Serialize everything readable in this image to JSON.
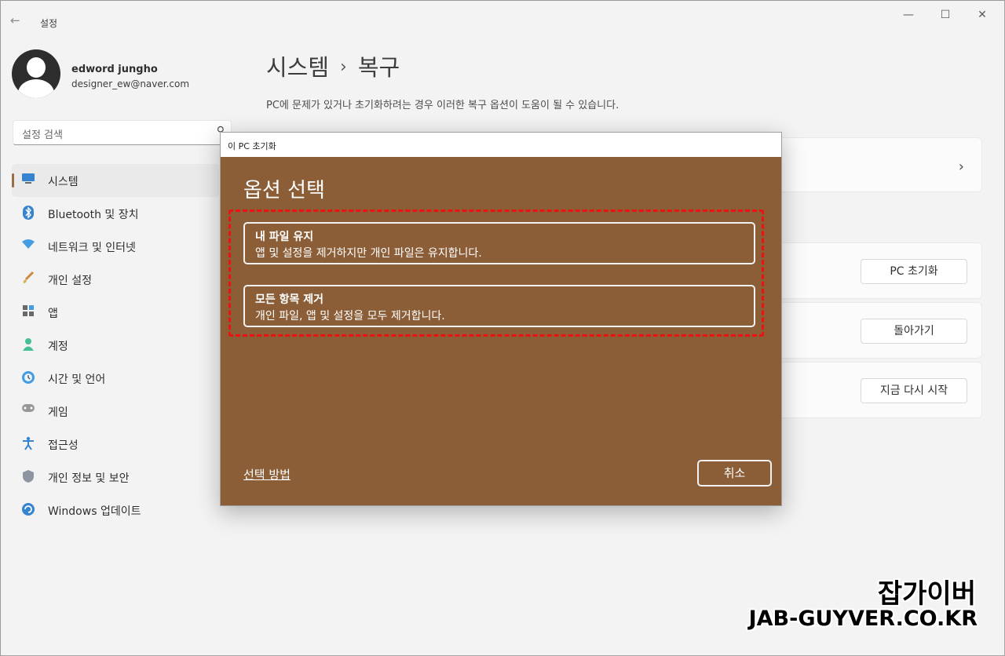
{
  "window": {
    "app_title": "설정",
    "back_icon": "back-arrow-icon",
    "controls": {
      "minimize": "—",
      "maximize": "☐",
      "close": "✕"
    }
  },
  "profile": {
    "name": "edword jungho",
    "email": "designer_ew@naver.com"
  },
  "search": {
    "placeholder": "설정 검색"
  },
  "sidebar": {
    "items": [
      {
        "label": "시스템",
        "icon": "system-display-icon",
        "active": true
      },
      {
        "label": "Bluetooth 및 장치",
        "icon": "bluetooth-icon"
      },
      {
        "label": "네트워크 및 인터넷",
        "icon": "wifi-icon"
      },
      {
        "label": "개인 설정",
        "icon": "brush-icon"
      },
      {
        "label": "앱",
        "icon": "apps-icon"
      },
      {
        "label": "계정",
        "icon": "account-icon"
      },
      {
        "label": "시간 및 언어",
        "icon": "time-language-icon"
      },
      {
        "label": "게임",
        "icon": "game-controller-icon"
      },
      {
        "label": "접근성",
        "icon": "accessibility-icon"
      },
      {
        "label": "개인 정보 및 보안",
        "icon": "shield-icon"
      },
      {
        "label": "Windows 업데이트",
        "icon": "windows-update-icon"
      }
    ]
  },
  "main": {
    "breadcrumb": {
      "parent": "시스템",
      "separator": "›",
      "current": "복구"
    },
    "subtitle": "PC에 문제가 있거나 초기화하려는 경우 이러한 복구 옵션이 도움이 될 수 있습니다.",
    "cards": {
      "reset_button": "PC 초기화",
      "goback_button": "돌아가기",
      "restart_button": "지금 다시 시작"
    }
  },
  "dialog": {
    "title": "이 PC 초기화",
    "heading": "옵션 선택",
    "options": [
      {
        "title": "내 파일 유지",
        "description": "앱 및 설정을 제거하지만 개인 파일은 유지합니다."
      },
      {
        "title": "모든 항목 제거",
        "description": "개인 파일, 앱 및 설정을 모두 제거합니다."
      }
    ],
    "help_link": "선택 방법",
    "cancel_label": "취소",
    "accent_color": "#8b5e37",
    "highlight_color": "#ee1111"
  },
  "watermark": {
    "korean": "잡가이버",
    "url": "JAB-GUYVER.CO.KR"
  }
}
